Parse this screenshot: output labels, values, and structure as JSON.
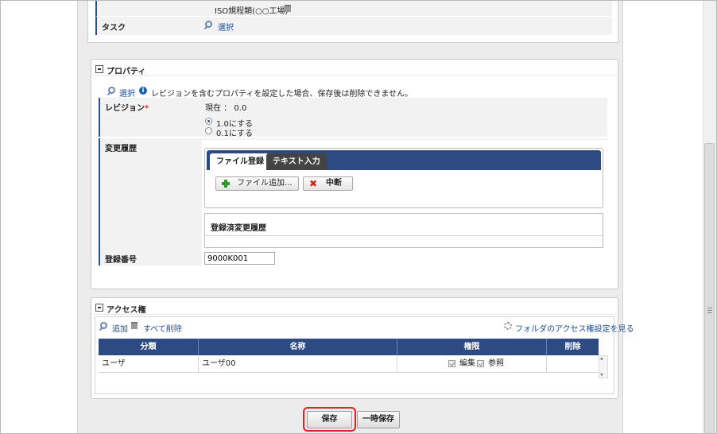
{
  "top_panel": {
    "iso_item": "ISO規程類(○○工場)",
    "task_label": "タスク",
    "task_select": "選択"
  },
  "property": {
    "title": "プロパティ",
    "select_link": "選択",
    "info_text": "レビジョンを含むプロパティを設定した場合、保存後は削除できません。",
    "revision_label": "レビジョン",
    "required_mark": "*",
    "current_text": "現在 ： 0.0",
    "radio_options": [
      "1.0にする",
      "0.1にする"
    ],
    "history_label": "変更履歴",
    "tabs": [
      "ファイル登録",
      "テキスト入力"
    ],
    "add_file_button": "ファイル追加...",
    "cancel_button": "中断",
    "registered_history_title": "登録済変更履歴",
    "reg_number_label": "登録番号",
    "reg_number_value": "9000K001"
  },
  "access": {
    "title": "アクセス権",
    "add_link": "追加",
    "delete_all_link": "すべて削除",
    "folder_link": "フォルダのアクセス権設定を見る",
    "columns": [
      "分類",
      "名称",
      "権限",
      "削除"
    ],
    "rows": [
      {
        "type": "ユーザ",
        "name": "ユーザ00",
        "perm_edit": "編集",
        "perm_view": "参照"
      }
    ]
  },
  "footer": {
    "save_button": "保存",
    "temp_save_button": "一時保存"
  }
}
